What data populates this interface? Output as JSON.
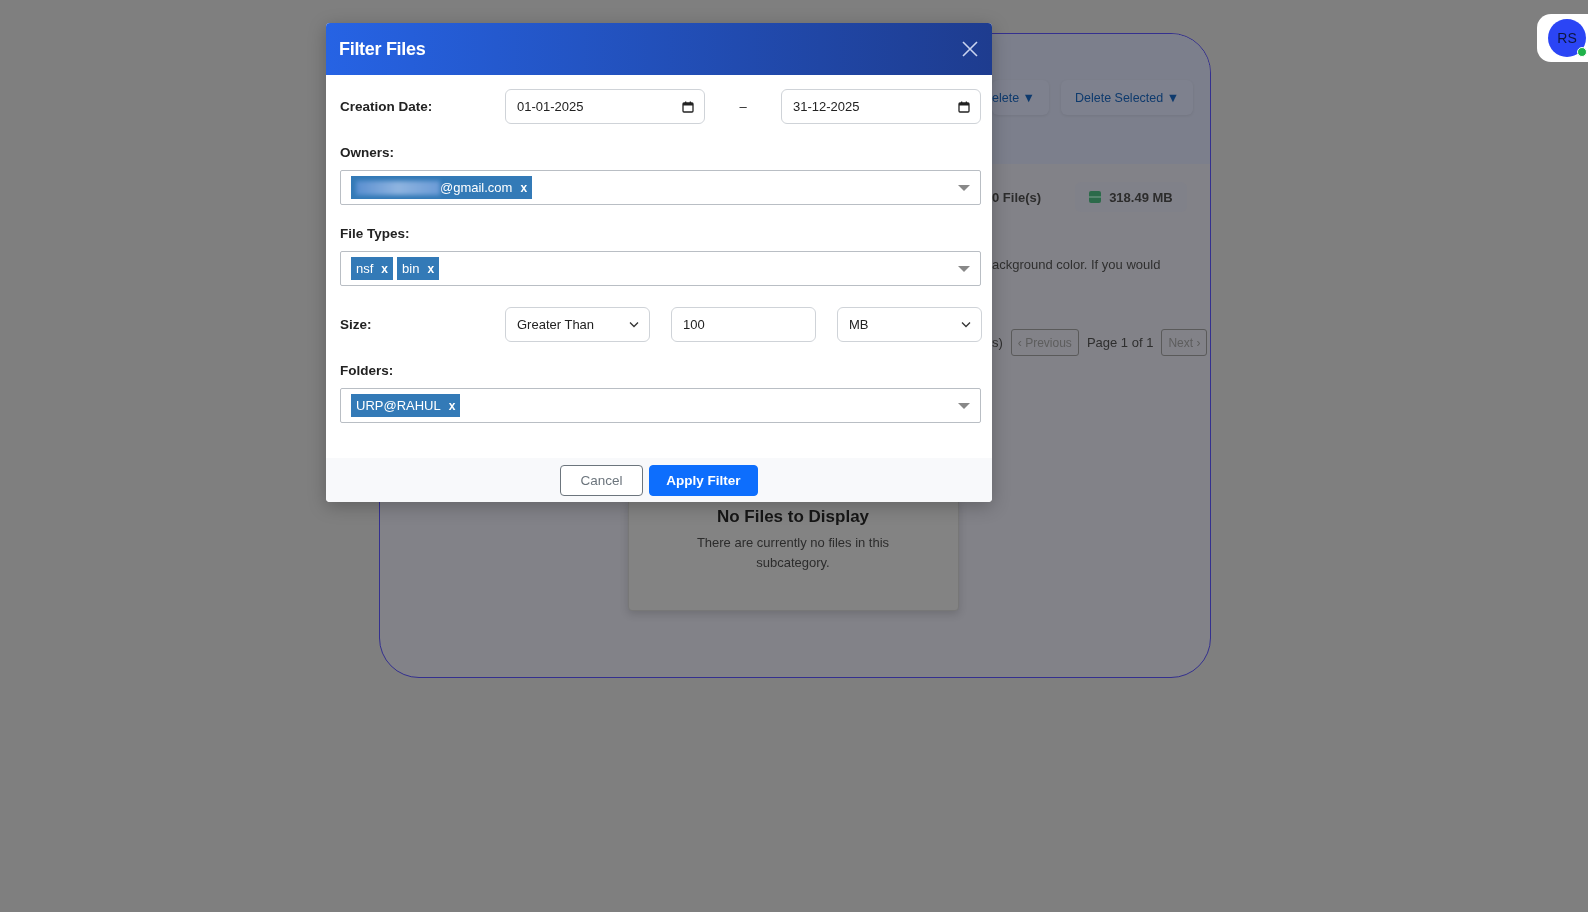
{
  "background_page": {
    "toolbar_buttons": [
      {
        "label": "elete ▼"
      },
      {
        "label": "Delete Selected ▼"
      }
    ],
    "stats": [
      {
        "kind": "count",
        "text": "0 File(s)"
      },
      {
        "kind": "storage",
        "text": "318.49 MB"
      }
    ],
    "notice": "ackground color. If you would",
    "pagination": {
      "range_text": "s)",
      "previous": {
        "label": "‹ Previous",
        "disabled": true
      },
      "page": "Page 1 of 1",
      "next": {
        "label": "Next ›",
        "disabled": true
      }
    },
    "empty_state": {
      "title": "No Files to Display",
      "message": "There are currently no files in this subcategory."
    }
  },
  "avatar": {
    "initials": "RS",
    "online": true
  },
  "dialog": {
    "title": "Filter Files",
    "creation_date": {
      "label": "Creation Date:",
      "from": "01-01-2025",
      "separator": "–",
      "to": "31-12-2025"
    },
    "owners": {
      "label": "Owners:",
      "chips": [
        {
          "text": "@gmail.com",
          "redacted": true,
          "remove": "x"
        }
      ]
    },
    "file_types": {
      "label": "File Types:",
      "chips": [
        {
          "text": "nsf",
          "redacted": false,
          "remove": "x"
        },
        {
          "text": "bin",
          "redacted": false,
          "remove": "x"
        }
      ]
    },
    "size": {
      "label": "Size:",
      "comparison": "Greater Than",
      "value": "100",
      "unit": "MB"
    },
    "folders": {
      "label": "Folders:",
      "chips": [
        {
          "text": "URP@RAHUL",
          "redacted": false,
          "remove": "x"
        }
      ]
    },
    "buttons": [
      {
        "kind": "secondary",
        "label": "Cancel"
      },
      {
        "kind": "primary",
        "label": "Apply Filter"
      }
    ]
  }
}
